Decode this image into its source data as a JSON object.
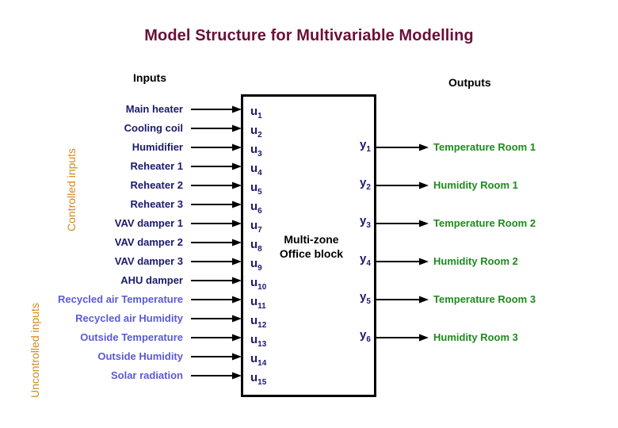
{
  "title": "Model Structure for Multivariable Modelling",
  "headers": {
    "inputs": "Inputs",
    "outputs": "Outputs"
  },
  "groups": {
    "controlled": "Controlled inputs",
    "uncontrolled": "Uncontrolled inputs"
  },
  "block": {
    "line1": "Multi-zone",
    "line2": "Office block"
  },
  "colors": {
    "title": "#6b0f3a",
    "controlled_text": "#1a1a6e",
    "uncontrolled_text": "#5a5ad8",
    "output_text": "#1e8a1e",
    "group_label": "#d08a1e"
  },
  "inputs": [
    {
      "label": "Main heater",
      "symbol": "u",
      "index": "1",
      "group": "controlled"
    },
    {
      "label": "Cooling coil",
      "symbol": "u",
      "index": "2",
      "group": "controlled"
    },
    {
      "label": "Humidifier",
      "symbol": "u",
      "index": "3",
      "group": "controlled"
    },
    {
      "label": "Reheater 1",
      "symbol": "u",
      "index": "4",
      "group": "controlled"
    },
    {
      "label": "Reheater 2",
      "symbol": "u",
      "index": "5",
      "group": "controlled"
    },
    {
      "label": "Reheater 3",
      "symbol": "u",
      "index": "6",
      "group": "controlled"
    },
    {
      "label": "VAV damper 1",
      "symbol": "u",
      "index": "7",
      "group": "controlled"
    },
    {
      "label": "VAV damper 2",
      "symbol": "u",
      "index": "8",
      "group": "controlled"
    },
    {
      "label": "VAV damper 3",
      "symbol": "u",
      "index": "9",
      "group": "controlled"
    },
    {
      "label": "AHU damper",
      "symbol": "u",
      "index": "10",
      "group": "controlled"
    },
    {
      "label": "Recycled air Temperature",
      "symbol": "u",
      "index": "11",
      "group": "uncontrolled"
    },
    {
      "label": "Recycled air Humidity",
      "symbol": "u",
      "index": "12",
      "group": "uncontrolled"
    },
    {
      "label": "Outside Temperature",
      "symbol": "u",
      "index": "13",
      "group": "uncontrolled"
    },
    {
      "label": "Outside Humidity",
      "symbol": "u",
      "index": "14",
      "group": "uncontrolled"
    },
    {
      "label": "Solar radiation",
      "symbol": "u",
      "index": "15",
      "group": "uncontrolled"
    }
  ],
  "outputs": [
    {
      "label": "Temperature Room 1",
      "symbol": "y",
      "index": "1"
    },
    {
      "label": "Humidity Room 1",
      "symbol": "y",
      "index": "2"
    },
    {
      "label": "Temperature Room 2",
      "symbol": "y",
      "index": "3"
    },
    {
      "label": "Humidity Room 2",
      "symbol": "y",
      "index": "4"
    },
    {
      "label": "Temperature Room 3",
      "symbol": "y",
      "index": "5"
    },
    {
      "label": "Humidity Room 3",
      "symbol": "y",
      "index": "6"
    }
  ]
}
